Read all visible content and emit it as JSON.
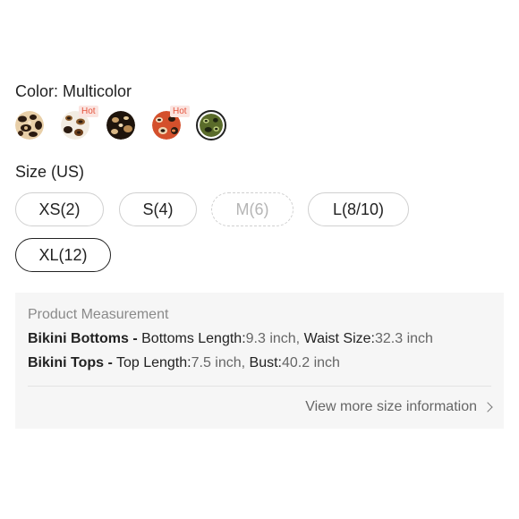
{
  "color": {
    "label": "Color: Multicolor",
    "swatches": [
      {
        "name": "leopard-light",
        "hot": false,
        "hot_label": ""
      },
      {
        "name": "leopard-white",
        "hot": true,
        "hot_label": "Hot"
      },
      {
        "name": "leopard-dark",
        "hot": false,
        "hot_label": ""
      },
      {
        "name": "leopard-red",
        "hot": true,
        "hot_label": "Hot"
      },
      {
        "name": "leopard-green",
        "hot": false,
        "hot_label": "",
        "selected": true
      }
    ]
  },
  "size": {
    "label": "Size (US)",
    "options": [
      {
        "label": "XS(2)",
        "state": "available"
      },
      {
        "label": "S(4)",
        "state": "available"
      },
      {
        "label": "M(6)",
        "state": "disabled"
      },
      {
        "label": "L(8/10)",
        "state": "available"
      },
      {
        "label": "XL(12)",
        "state": "selected"
      }
    ]
  },
  "measurement": {
    "title": "Product Measurement",
    "bottoms": {
      "name": "Bikini Bottoms -",
      "length_label": "Bottoms Length:",
      "length_value": "9.3 inch,",
      "waist_label": "Waist Size:",
      "waist_value": "32.3 inch"
    },
    "tops": {
      "name": "Bikini Tops -",
      "length_label": "Top Length:",
      "length_value": "7.5 inch,",
      "bust_label": "Bust:",
      "bust_value": "40.2 inch"
    },
    "view_more": "View more size information",
    "view_more_icon": "chevron-right-icon"
  },
  "colors": {
    "hot_badge_bg": "#fbe4e0",
    "hot_badge_text": "#e5533c",
    "selected_border": "#222222"
  }
}
